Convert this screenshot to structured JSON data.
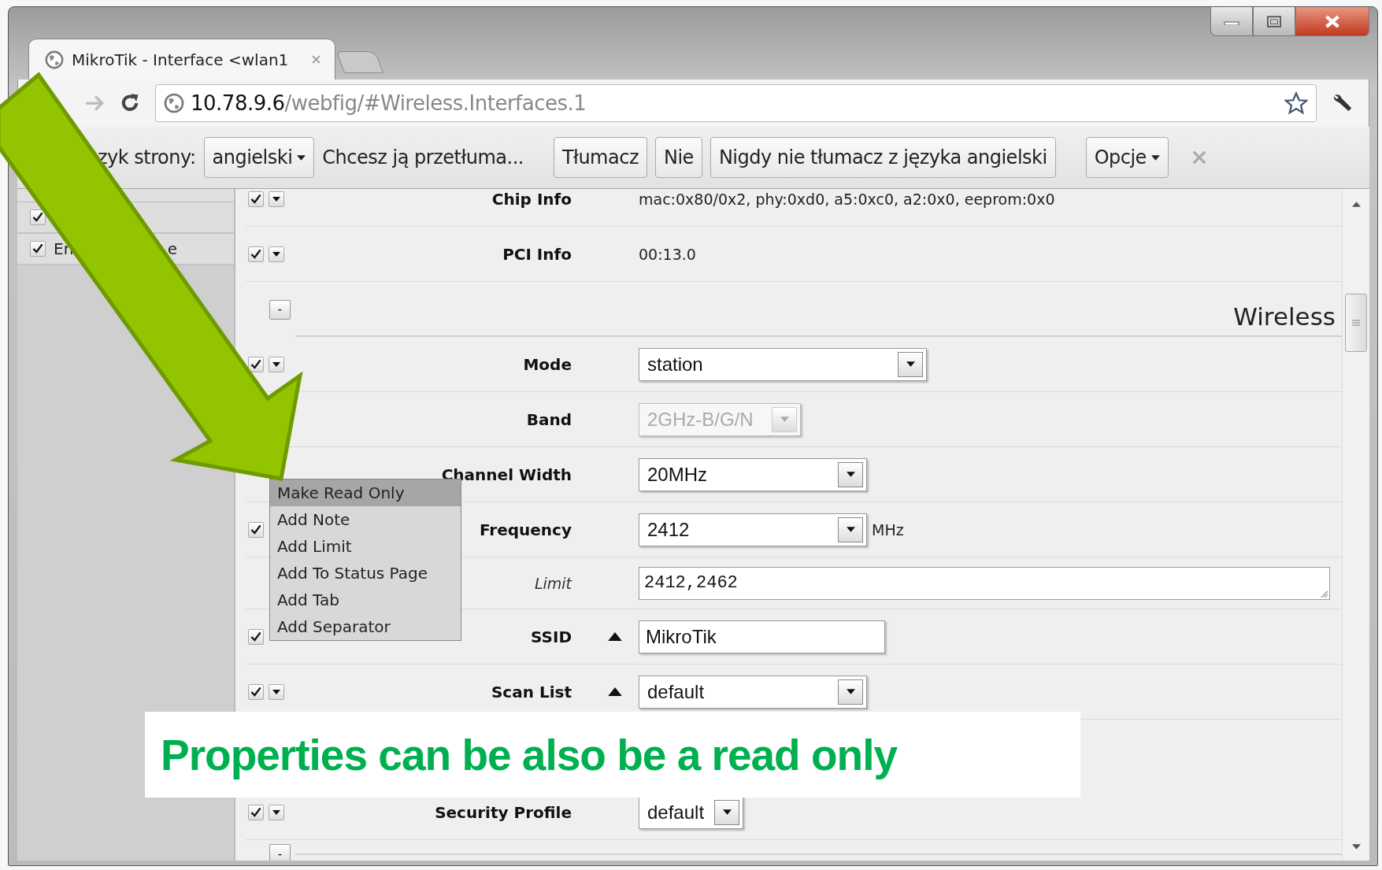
{
  "tabs": [
    {
      "title": "MikroTik - Interface <wlan1",
      "selected": true
    }
  ],
  "toolbar": {
    "url_host": "10.78.9.6",
    "url_path": "/webfig/#Wireless.Interfaces.1"
  },
  "translate_bar": {
    "label": "zyk strony:",
    "language": "angielski",
    "question": "Chcesz ją przetłuma...",
    "buttons": [
      "Tłumacz",
      "Nie",
      "Nigdy nie tłumacz z języka angielski"
    ],
    "options": "Opcje"
  },
  "sidebar": {
    "items": [
      {
        "checked": true
      },
      {
        "checked": true,
        "label_parts": [
          "En",
          "e"
        ]
      }
    ]
  },
  "rows": [
    {
      "kind": "property",
      "label": "Chip Info",
      "controls": {
        "checked": true,
        "menu": true
      },
      "value": {
        "kind": "text",
        "text": "mac:0x80/0x2, phy:0xd0, a5:0xc0, a2:0x0, eeprom:0x0"
      }
    },
    {
      "kind": "property",
      "label": "PCI Info",
      "controls": {
        "checked": true,
        "menu": true
      },
      "value": {
        "kind": "text",
        "text": "00:13.0"
      }
    },
    {
      "kind": "section",
      "button": "-",
      "heading": "Wireless"
    },
    {
      "kind": "property",
      "label": "Mode",
      "controls": {
        "checked": true,
        "menu": true
      },
      "value": {
        "kind": "select",
        "text": "station",
        "disabled": false
      }
    },
    {
      "kind": "property",
      "label": "Band",
      "value": {
        "kind": "select",
        "text": "2GHz-B/G/N",
        "disabled": true
      }
    },
    {
      "kind": "property",
      "label": "Channel Width",
      "value": {
        "kind": "select",
        "text": "20MHz",
        "disabled": false
      }
    },
    {
      "kind": "property",
      "label": "Frequency",
      "controls": {
        "checked": true
      },
      "value": {
        "kind": "select",
        "text": "2412",
        "disabled": false
      },
      "unit": "MHz"
    },
    {
      "kind": "limit",
      "label": "Limit",
      "value": {
        "kind": "textarea",
        "text": "2412,2462"
      }
    },
    {
      "kind": "property",
      "label": "SSID",
      "controls": {
        "checked": true
      },
      "expander": true,
      "value": {
        "kind": "input",
        "text": "MikroTik"
      }
    },
    {
      "kind": "property",
      "label": "Scan List",
      "controls": {
        "checked": true,
        "menu": true
      },
      "expander": true,
      "value": {
        "kind": "select",
        "text": "default",
        "disabled": false
      }
    }
  ],
  "caption": {
    "text": "Properties can be also be a read only"
  },
  "rows_below_caption": [
    {
      "kind": "property",
      "label": "Security Profile",
      "controls": {
        "checked": true,
        "menu": true
      },
      "value": {
        "kind": "select",
        "text": "default",
        "disabled": false
      }
    },
    {
      "kind": "section",
      "button": "-"
    }
  ],
  "context_menu": {
    "items": [
      {
        "label": "Make Read Only",
        "selected": true
      },
      {
        "label": "Add Note",
        "selected": false
      },
      {
        "label": "Add Limit",
        "selected": false
      },
      {
        "label": "Add To Status Page",
        "selected": false
      },
      {
        "label": "Add Tab",
        "selected": false
      },
      {
        "label": "Add Separator",
        "selected": false
      }
    ]
  }
}
